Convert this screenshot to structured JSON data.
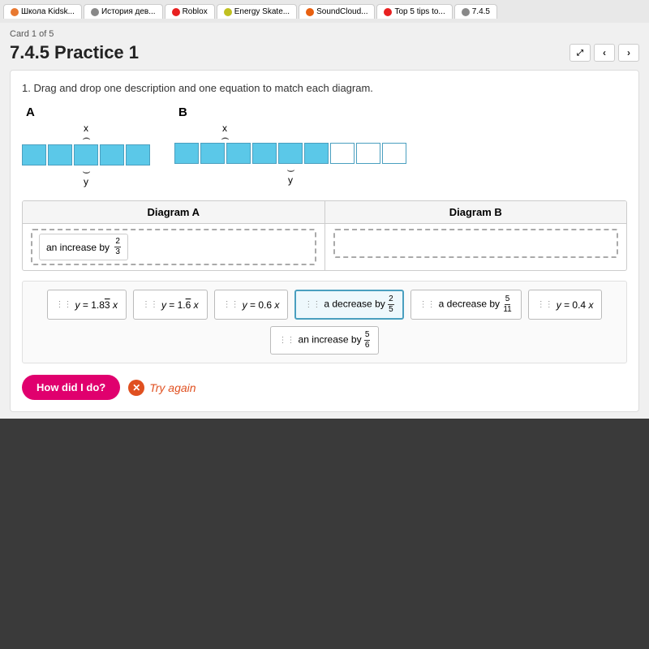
{
  "browser": {
    "tabs": [
      {
        "label": "Школа Kidsk...",
        "color": "#e87830"
      },
      {
        "label": "История дев...",
        "color": "#888"
      },
      {
        "label": "Roblox",
        "color": "#e82020"
      },
      {
        "label": "Energy Skate...",
        "color": "#c0c020"
      },
      {
        "label": "SoundCloud...",
        "color": "#e86010"
      },
      {
        "label": "Top 5 tips to...",
        "color": "#e82020"
      },
      {
        "label": "7.4.5",
        "color": "#888"
      }
    ]
  },
  "card_label": "Card 1 of 5",
  "page_title": "7.4.5 Practice 1",
  "instructions": "1. Drag and drop one description and one equation to match each diagram.",
  "diagram_a": {
    "label": "A",
    "x_label": "x",
    "y_label": "y",
    "filled_cells": 5,
    "total_cells": 5
  },
  "diagram_b": {
    "label": "B",
    "x_label": "x",
    "y_label": "y",
    "filled_cells": 6,
    "total_cells": 9
  },
  "table": {
    "headers": [
      "Diagram A",
      "Diagram B"
    ],
    "placed_a": "an increase by 2/3",
    "placed_b": ""
  },
  "chips": [
    {
      "id": "chip1",
      "text": "y = 1.83 x",
      "handle": "⋮⋮"
    },
    {
      "id": "chip2",
      "text": "y = 1.6̄ x",
      "handle": "⋮⋮"
    },
    {
      "id": "chip3",
      "text": "y = 0.6 x",
      "handle": "⋮⋮"
    },
    {
      "id": "chip4",
      "text": "a decrease by 2/5",
      "handle": "⋮⋮",
      "highlighted": true
    },
    {
      "id": "chip5",
      "text": "a decrease by 5/11",
      "handle": "⋮⋮"
    },
    {
      "id": "chip6",
      "text": "y = 0.4 x",
      "handle": "⋮⋮"
    },
    {
      "id": "chip7",
      "text": "an increase by 5/6",
      "handle": "⋮⋮"
    }
  ],
  "buttons": {
    "how_did_i_do": "How did I do?",
    "try_again": "Try again",
    "x_icon": "✕",
    "prev": "‹",
    "next": "›",
    "expand": "⤢"
  }
}
